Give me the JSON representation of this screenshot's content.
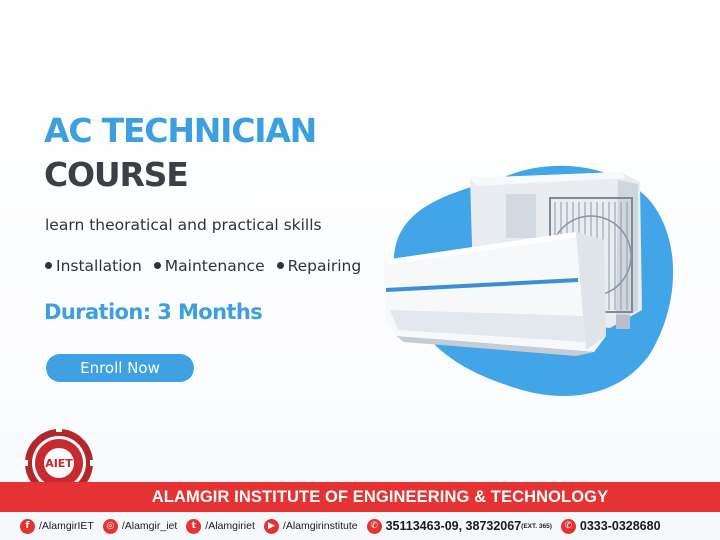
{
  "hero": {
    "title_line1": "AC TECHNICIAN",
    "title_line2": "COURSE",
    "tagline": "learn theoratical and practical skills",
    "bullets": [
      "Installation",
      "Maintenance",
      "Repairing"
    ],
    "duration": "Duration: 3 Months",
    "cta_label": "Enroll Now"
  },
  "brand": {
    "logo_text": "AIET",
    "institute_name": "ALAMGIR INSTITUTE OF ENGINEERING & TECHNOLOGY"
  },
  "footer": {
    "facebook": "/AlamgirIET",
    "instagram": "/Alamgir_iet",
    "twitter": "/Alamgiriet",
    "youtube": "/Alamgirinstitute",
    "phone": "35113463-09, 38732067",
    "phone_ext": "(EXT. 365)",
    "whatsapp": "0333-0328680"
  },
  "colors": {
    "accent_blue": "#3b9fe0",
    "dark_text": "#3b3f46",
    "brand_red": "#e53232"
  }
}
